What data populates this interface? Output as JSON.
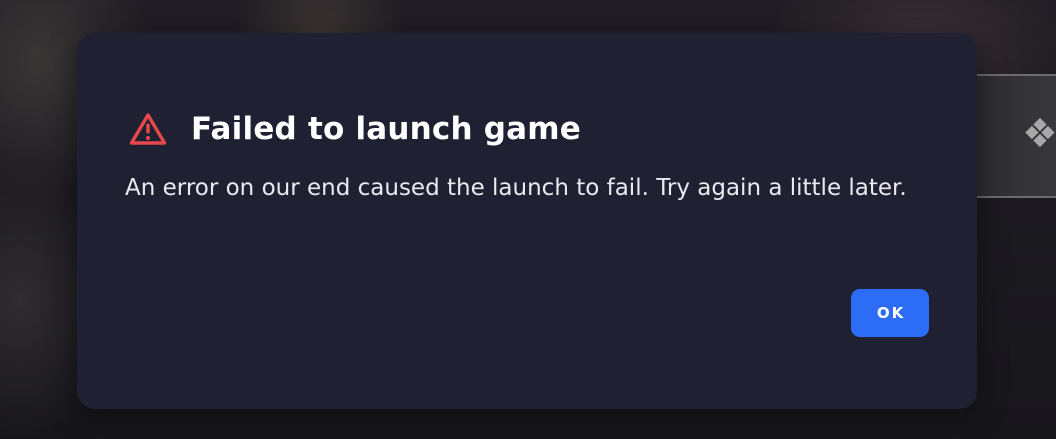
{
  "dialog": {
    "title": "Failed to launch game",
    "message": "An error on our end caused the launch to fail. Try again a little later.",
    "icon": "warning-triangle-icon",
    "ok_label": "OK"
  },
  "colors": {
    "dialog_background": "#1f2133",
    "warning_red": "#e8484b",
    "primary_button": "#2d6cf6",
    "title_text": "#ffffff",
    "body_text": "#e9e9ee"
  }
}
